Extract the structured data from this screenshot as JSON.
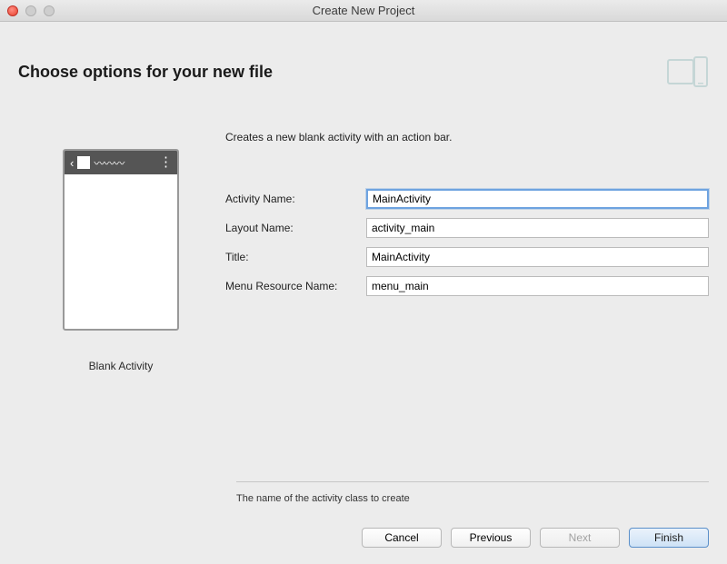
{
  "window": {
    "title": "Create New Project"
  },
  "page": {
    "title": "Choose options for your new file"
  },
  "preview": {
    "label": "Blank Activity"
  },
  "form": {
    "description": "Creates a new blank activity with an action bar.",
    "fields": {
      "activity_name": {
        "label": "Activity Name:",
        "value": "MainActivity"
      },
      "layout_name": {
        "label": "Layout Name:",
        "value": "activity_main"
      },
      "title": {
        "label": "Title:",
        "value": "MainActivity"
      },
      "menu_resource": {
        "label": "Menu Resource Name:",
        "value": "menu_main"
      }
    },
    "hint": "The name of the activity class to create"
  },
  "buttons": {
    "cancel": "Cancel",
    "previous": "Previous",
    "next": "Next",
    "finish": "Finish"
  }
}
